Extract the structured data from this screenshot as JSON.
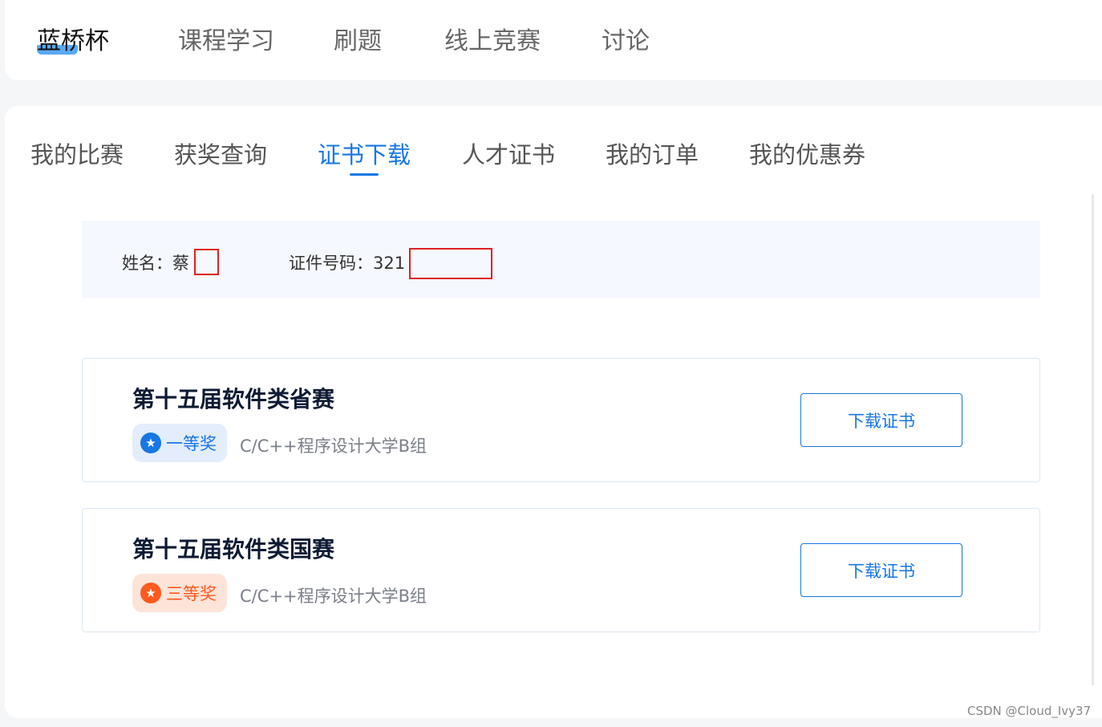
{
  "topnav": {
    "items": [
      "蓝桥杯",
      "课程学习",
      "刷题",
      "线上竞赛",
      "讨论"
    ]
  },
  "subtabs": [
    "我的比赛",
    "获奖查询",
    "证书下载",
    "人才证书",
    "我的订单",
    "我的优惠券"
  ],
  "info": {
    "name_label": "姓名：蔡",
    "id_label": "证件号码：321"
  },
  "cards": [
    {
      "title": "第十五届软件类省赛",
      "medal_icon": "star-medal-icon",
      "award": "一等奖",
      "award_color": "#1677e5",
      "category": "C/C++程序设计大学B组",
      "button": "下载证书"
    },
    {
      "title": "第十五届软件类国赛",
      "medal_icon": "star-medal-icon",
      "award": "三等奖",
      "award_color": "#ff5a1f",
      "category": "C/C++程序设计大学B组",
      "button": "下载证书"
    }
  ],
  "watermark": "CSDN @Cloud_Ivy37",
  "colors": {
    "accent": "#1677e5",
    "redaction": "#e02020"
  }
}
